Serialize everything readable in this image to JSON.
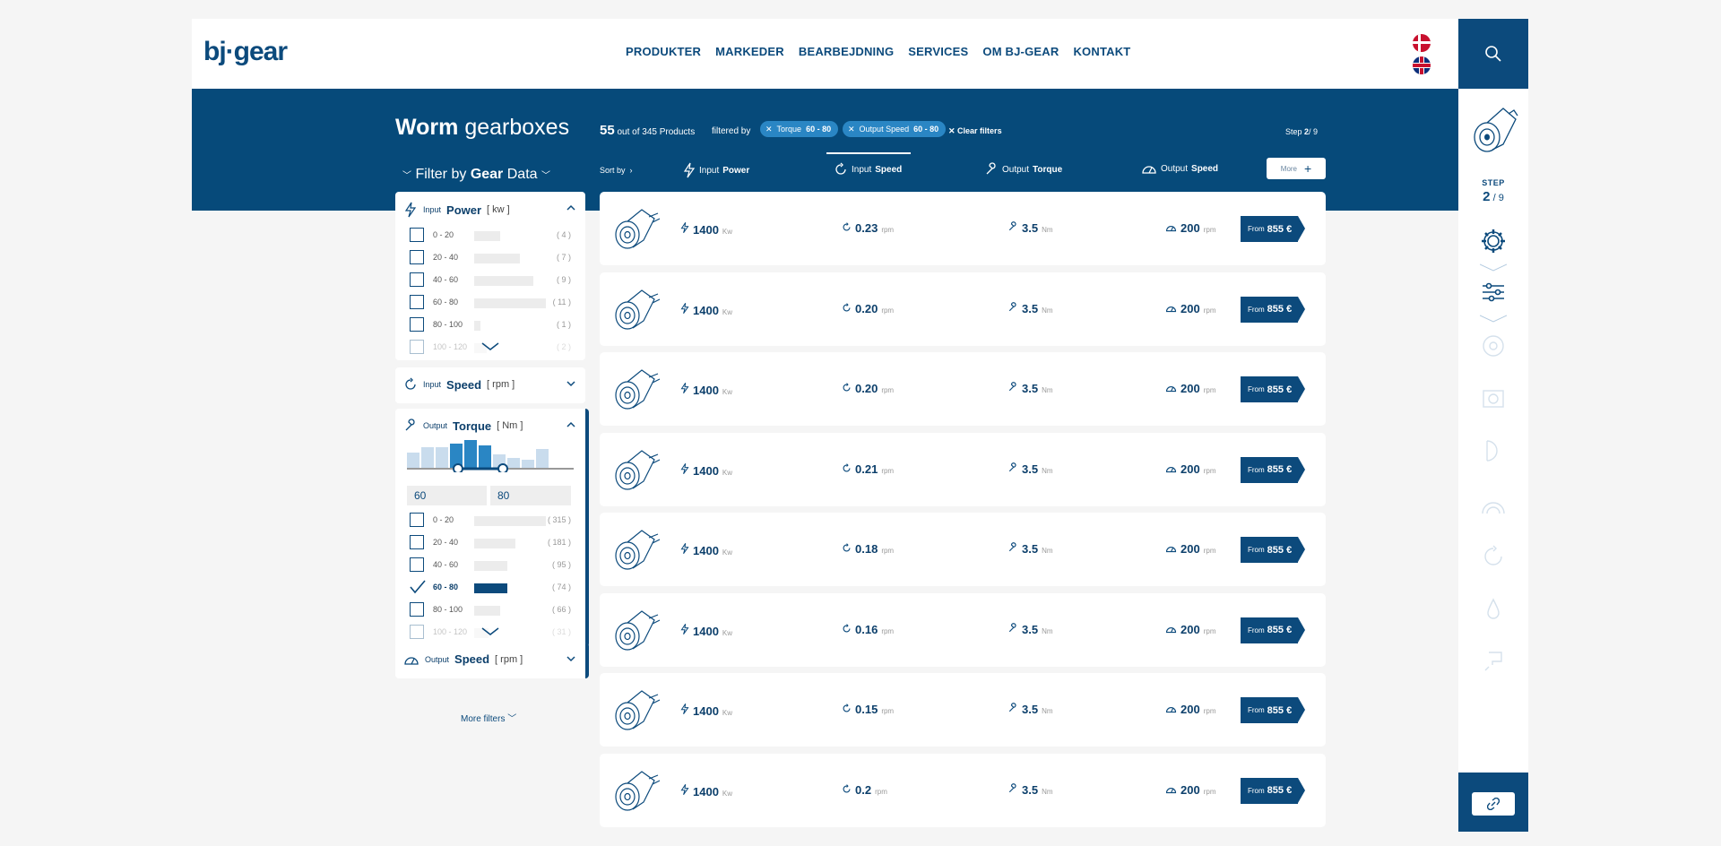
{
  "header": {
    "logo": "bj·gear",
    "nav": [
      "PRODUKTER",
      "MARKEDER",
      "BEARBEJDNING",
      "SERVICES",
      "OM BJ-GEAR",
      "KONTAKT"
    ]
  },
  "band": {
    "title_bold": "Worm",
    "title_rest": " gearboxes",
    "count": "55",
    "count_text": " out of 345 Products",
    "filtered_by": "filtered by",
    "chips": [
      {
        "label": "Torque",
        "value": "60 - 80"
      },
      {
        "label": "Output Speed",
        "value": "60 - 80"
      }
    ],
    "clear_filters": "Clear filters",
    "step_label": "Step",
    "step_current": "2",
    "step_total": "/ 9",
    "filter_by": "Filter by",
    "filter_gear": "Gear",
    "filter_data": "Data",
    "sort_by": "Sort by",
    "sort_tabs": [
      {
        "pre": "Input",
        "bold": "Power"
      },
      {
        "pre": "Input",
        "bold": "Speed"
      },
      {
        "pre": "Output",
        "bold": "Torque"
      },
      {
        "pre": "Output",
        "bold": "Speed"
      }
    ],
    "more": "More"
  },
  "filters": {
    "power": {
      "pre": "Input",
      "title": "Power",
      "unit": "[ kw ]",
      "options": [
        {
          "label": "0 - 20",
          "count": "( 4 )",
          "share": 0.36
        },
        {
          "label": "20 - 40",
          "count": "( 7 )",
          "share": 0.64
        },
        {
          "label": "40 - 60",
          "count": "( 9 )",
          "share": 0.82
        },
        {
          "label": "60 - 80",
          "count": "( 11 )",
          "share": 1.0
        },
        {
          "label": "80 - 100",
          "count": "( 1 )",
          "share": 0.09
        },
        {
          "label": "100 - 120",
          "count": "( 2 )",
          "share": 0.18
        }
      ]
    },
    "input_speed": {
      "pre": "Input",
      "title": "Speed",
      "unit": "[ rpm ]"
    },
    "torque": {
      "pre": "Output",
      "title": "Torque",
      "unit": "[ Nm ]",
      "range_min": "60",
      "range_max": "80",
      "options": [
        {
          "label": "0 - 20",
          "count": "( 315 )",
          "share": 1.0,
          "checked": false
        },
        {
          "label": "20 - 40",
          "count": "( 181 )",
          "share": 0.57,
          "checked": false
        },
        {
          "label": "40 - 60",
          "count": "( 95 )",
          "share": 0.46,
          "checked": false
        },
        {
          "label": "60 - 80",
          "count": "( 74 )",
          "share": 0.46,
          "checked": true
        },
        {
          "label": "80 - 100",
          "count": "( 66 )",
          "share": 0.36,
          "checked": false
        },
        {
          "label": "100 - 120",
          "count": "( 31 )",
          "share": 0.2,
          "checked": false
        }
      ]
    },
    "output_speed": {
      "pre": "Output",
      "title": "Speed",
      "unit": "[ rpm ]"
    },
    "more_filters": "More filters"
  },
  "products": [
    {
      "power": "1400",
      "power_unit": "Kw",
      "speed": "0.23",
      "speed_unit": "rpm",
      "torque": "3.5",
      "torque_unit": "Nm",
      "out_speed": "200",
      "out_speed_unit": "rpm",
      "price_from": "From",
      "price": "855 €"
    },
    {
      "power": "1400",
      "power_unit": "Kw",
      "speed": "0.20",
      "speed_unit": "rpm",
      "torque": "3.5",
      "torque_unit": "Nm",
      "out_speed": "200",
      "out_speed_unit": "rpm",
      "price_from": "From",
      "price": "855 €"
    },
    {
      "power": "1400",
      "power_unit": "Kw",
      "speed": "0.20",
      "speed_unit": "rpm",
      "torque": "3.5",
      "torque_unit": "Nm",
      "out_speed": "200",
      "out_speed_unit": "rpm",
      "price_from": "From",
      "price": "855 €"
    },
    {
      "power": "1400",
      "power_unit": "Kw",
      "speed": "0.21",
      "speed_unit": "rpm",
      "torque": "3.5",
      "torque_unit": "Nm",
      "out_speed": "200",
      "out_speed_unit": "rpm",
      "price_from": "From",
      "price": "855 €"
    },
    {
      "power": "1400",
      "power_unit": "Kw",
      "speed": "0.18",
      "speed_unit": "rpm",
      "torque": "3.5",
      "torque_unit": "Nm",
      "out_speed": "200",
      "out_speed_unit": "rpm",
      "price_from": "From",
      "price": "855 €"
    },
    {
      "power": "1400",
      "power_unit": "Kw",
      "speed": "0.16",
      "speed_unit": "rpm",
      "torque": "3.5",
      "torque_unit": "Nm",
      "out_speed": "200",
      "out_speed_unit": "rpm",
      "price_from": "From",
      "price": "855 €"
    },
    {
      "power": "1400",
      "power_unit": "Kw",
      "speed": "0.15",
      "speed_unit": "rpm",
      "torque": "3.5",
      "torque_unit": "Nm",
      "out_speed": "200",
      "out_speed_unit": "rpm",
      "price_from": "From",
      "price": "855 €"
    },
    {
      "power": "1400",
      "power_unit": "Kw",
      "speed": "0.2",
      "speed_unit": "rpm",
      "torque": "3.5",
      "torque_unit": "Nm",
      "out_speed": "200",
      "out_speed_unit": "rpm",
      "price_from": "From",
      "price": "855 €"
    }
  ],
  "rail": {
    "step_label": "STEP",
    "step_current": "2",
    "step_total": "/ 9"
  },
  "colors": {
    "brand": "#064a7a",
    "accent": "#2a86c4"
  }
}
